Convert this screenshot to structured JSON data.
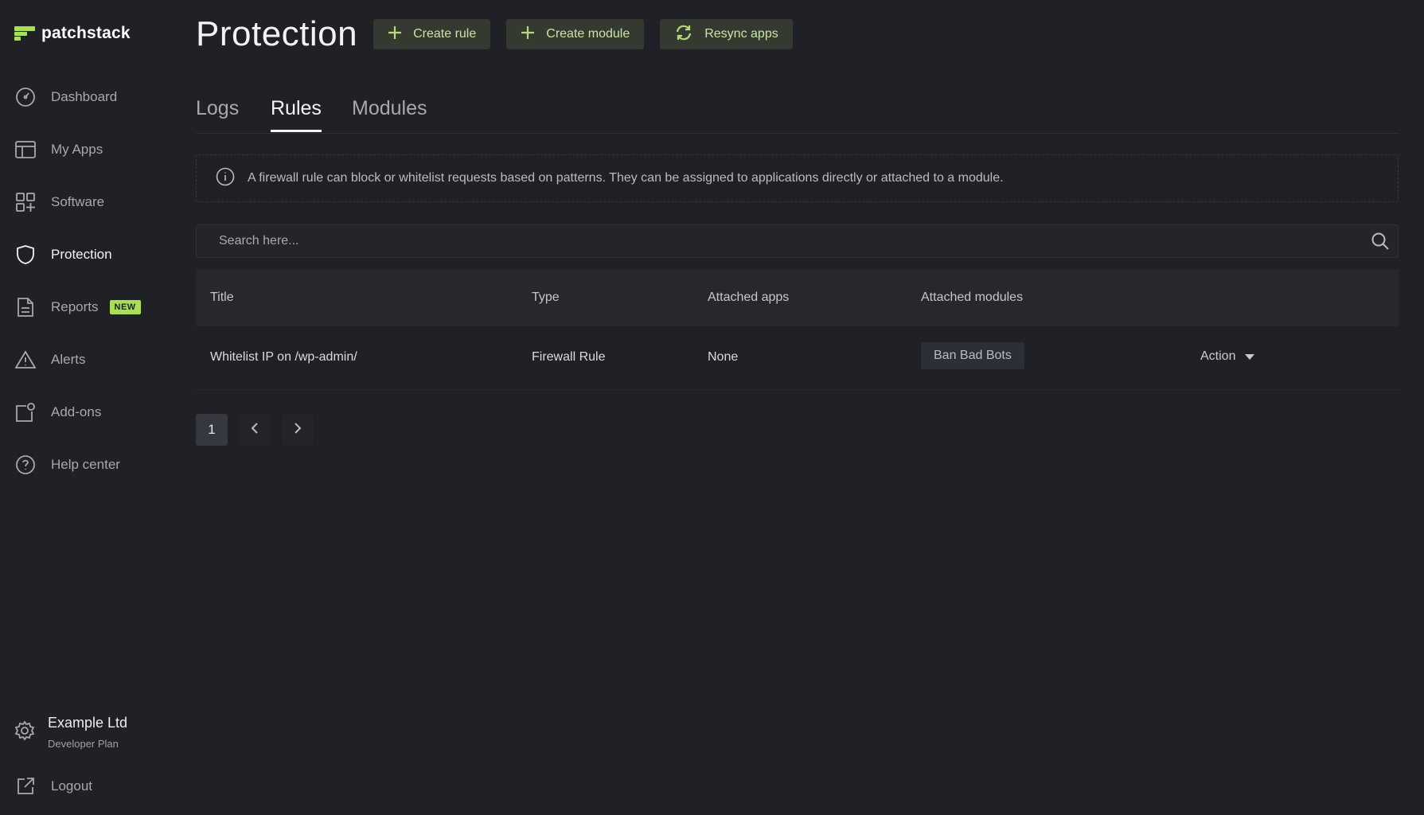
{
  "brand": {
    "name": "patchstack",
    "accent": "#a8e04f"
  },
  "sidebar": {
    "items": [
      {
        "label": "Dashboard",
        "icon": "gauge-icon"
      },
      {
        "label": "My Apps",
        "icon": "layout-icon"
      },
      {
        "label": "Software",
        "icon": "grid-plus-icon"
      },
      {
        "label": "Protection",
        "icon": "shield-icon",
        "active": true
      },
      {
        "label": "Reports",
        "icon": "document-icon",
        "badge": "NEW"
      },
      {
        "label": "Alerts",
        "icon": "warning-icon"
      },
      {
        "label": "Add-ons",
        "icon": "addon-icon"
      },
      {
        "label": "Help center",
        "icon": "help-icon"
      }
    ],
    "account": {
      "name": "Example Ltd",
      "plan": "Developer Plan",
      "icon": "gear-icon"
    },
    "logout": {
      "label": "Logout",
      "icon": "external-link-icon"
    }
  },
  "header": {
    "title": "Protection",
    "buttons": {
      "create_rule": "Create rule",
      "create_module": "Create module",
      "resync_apps": "Resync apps"
    }
  },
  "tabs": [
    {
      "label": "Logs"
    },
    {
      "label": "Rules",
      "active": true
    },
    {
      "label": "Modules"
    }
  ],
  "info_text": "A firewall rule can block or whitelist requests based on patterns. They can be assigned to applications directly or attached to a module.",
  "search": {
    "placeholder": "Search here..."
  },
  "table": {
    "columns": [
      "Title",
      "Type",
      "Attached apps",
      "Attached modules"
    ],
    "rows": [
      {
        "title": "Whitelist IP on /wp-admin/",
        "type": "Firewall Rule",
        "attached_apps": "None",
        "attached_modules": "Ban Bad Bots",
        "action": "Action"
      }
    ]
  },
  "pagination": {
    "current_page": "1"
  }
}
